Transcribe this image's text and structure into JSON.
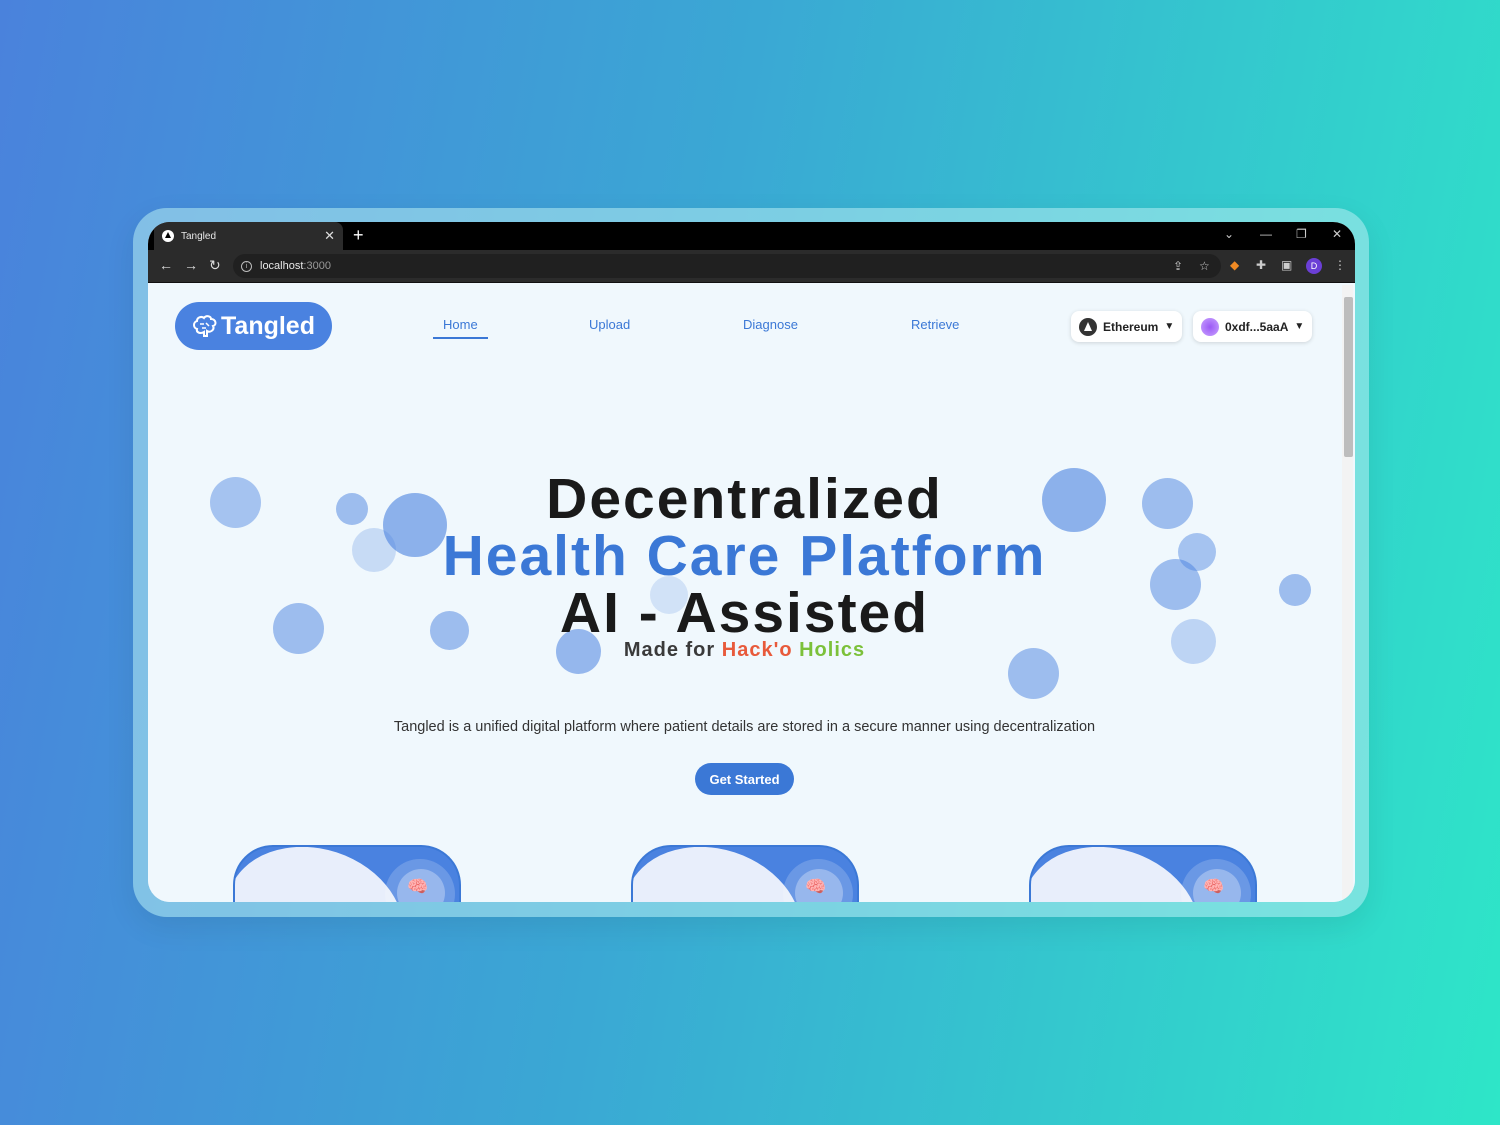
{
  "browser": {
    "tab_title": "Tangled",
    "tab_close": "✕",
    "new_tab": "+",
    "url_host": "localhost",
    "url_port": ":3000"
  },
  "site": {
    "logo_text": "Tangled",
    "nav": [
      {
        "label": "Home"
      },
      {
        "label": "Upload"
      },
      {
        "label": "Diagnose"
      },
      {
        "label": "Retrieve"
      }
    ],
    "network": "Ethereum",
    "account": "0xdf...5aaA"
  },
  "hero": {
    "line1": "Decentralized",
    "line2": "Health Care Platform",
    "line3": "AI - Assisted",
    "made_for": "Made for",
    "team_part1": "Hack'o",
    "team_part2": "Holics",
    "description": "Tangled is a unified digital platform where patient details are stored in a secure manner using decentralization",
    "cta": "Get Started"
  },
  "profile_initial": "D",
  "colors": {
    "primary": "#3b78d6",
    "hack": "#e85a3b",
    "holics": "#7cc13a"
  }
}
